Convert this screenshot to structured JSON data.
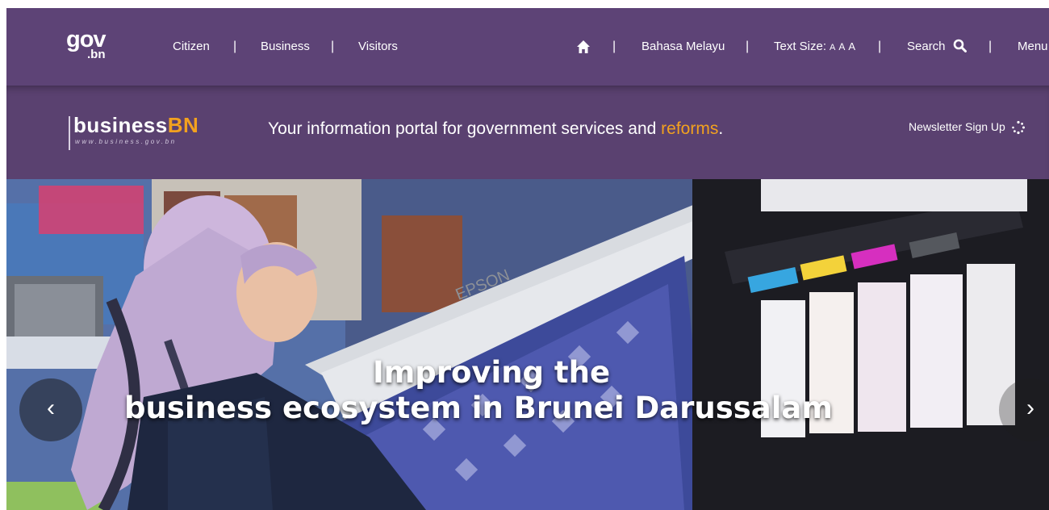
{
  "topbar": {
    "logo": {
      "gov": "gov",
      "bn": ".bn"
    },
    "nav": [
      "Citizen",
      "Business",
      "Visitors"
    ],
    "home_icon": "home-icon",
    "language": "Bahasa Melayu",
    "text_size_label": "Text Size:",
    "text_size_options": [
      "A",
      "A",
      "A"
    ],
    "search_label": "Search",
    "search_icon": "search-icon",
    "menu_label": "Menu",
    "separator": "|"
  },
  "portal": {
    "logo": {
      "word": "business",
      "accent": "BN",
      "url": "www.business.gov.bn"
    },
    "tagline_prefix": "Your information portal for government services and ",
    "tagline_accent": "reforms",
    "tagline_suffix": ".",
    "newsletter": "Newsletter Sign Up",
    "newsletter_icon": "spinner-icon"
  },
  "hero": {
    "line1": "Improving the",
    "line2": "business ecosystem in Brunei Darussalam",
    "printer_brand": "EPSON",
    "prev_icon": "chevron-left-icon",
    "next_icon": "chevron-right-icon",
    "prev_glyph": "‹",
    "next_glyph": "›"
  },
  "colors": {
    "topbar": "#5d4376",
    "portalbar": "#5a4170",
    "accent": "#f2a11f",
    "text": "#ffffff"
  }
}
